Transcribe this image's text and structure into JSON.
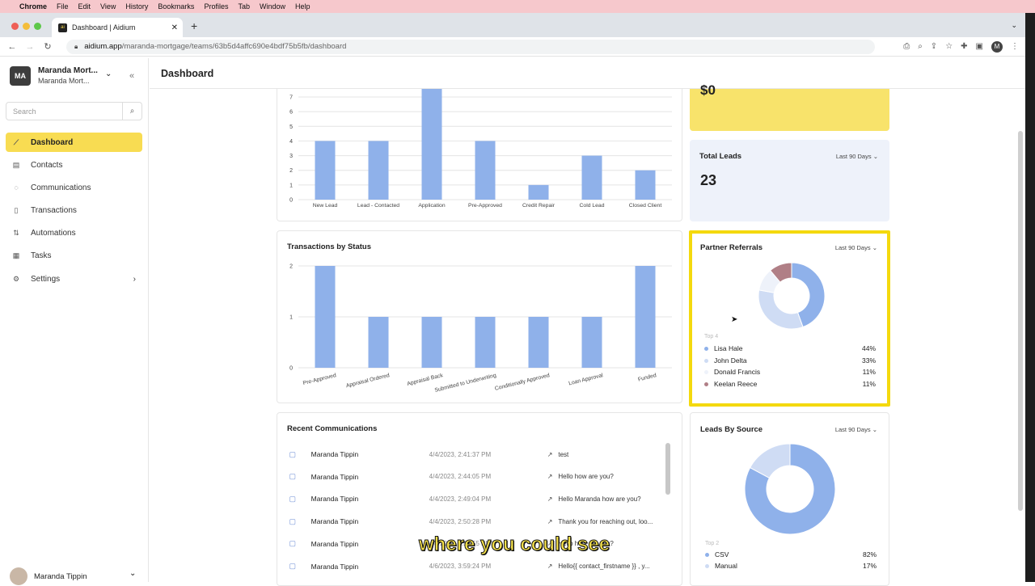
{
  "menubar": {
    "app": "Chrome",
    "items": [
      "File",
      "Edit",
      "View",
      "History",
      "Bookmarks",
      "Profiles",
      "Tab",
      "Window",
      "Help"
    ]
  },
  "browser": {
    "tab_title": "Dashboard | Aidium",
    "url_host": "aidium.app",
    "url_path": "/maranda-mortgage/teams/63b5d4affc690e4bdf75b5fb/dashboard",
    "profile_initial": "M"
  },
  "sidebar": {
    "org_initials": "MA",
    "org_name": "Maranda Mort...",
    "org_sub": "Maranda Mort...",
    "search_placeholder": "Search",
    "items": [
      {
        "label": "Dashboard",
        "icon": "chart-line-icon",
        "active": true
      },
      {
        "label": "Contacts",
        "icon": "contacts-icon"
      },
      {
        "label": "Communications",
        "icon": "chat-icon"
      },
      {
        "label": "Transactions",
        "icon": "document-icon"
      },
      {
        "label": "Automations",
        "icon": "automation-icon"
      },
      {
        "label": "Tasks",
        "icon": "calendar-icon"
      },
      {
        "label": "Settings",
        "icon": "gear-icon"
      }
    ],
    "user_name": "Maranda Tippin"
  },
  "header": {
    "title": "Dashboard"
  },
  "stats": {
    "revenue_value": "$0",
    "total_leads_title": "Total Leads",
    "total_leads_range": "Last 90 Days",
    "total_leads_value": "23"
  },
  "leads_chart": {
    "chart_data": {
      "type": "bar",
      "categories": [
        "New Lead",
        "Lead - Contacted",
        "Application",
        "Pre-Approved",
        "Credit Repair",
        "Cold Lead",
        "Closed Client"
      ],
      "values": [
        4,
        4,
        8,
        4,
        1,
        3,
        2
      ],
      "ylim": [
        0,
        7
      ],
      "yticks": [
        0,
        1,
        2,
        3,
        4,
        5,
        6,
        7
      ]
    }
  },
  "transactions_chart": {
    "title": "Transactions by Status",
    "chart_data": {
      "type": "bar",
      "title": "Transactions by Status",
      "categories": [
        "Pre-Approved",
        "Appraisal Ordered",
        "Appraisal Back",
        "Submitted to Underwriting",
        "Conditionally Approved",
        "Loan Approval",
        "Funded"
      ],
      "values": [
        2,
        1,
        1,
        1,
        1,
        1,
        2
      ],
      "ylim": [
        0,
        2
      ],
      "yticks": [
        0,
        1,
        2
      ]
    }
  },
  "partner_referrals": {
    "title": "Partner Referrals",
    "range": "Last 90 Days",
    "top_label": "Top 4",
    "chart_data": {
      "type": "pie",
      "categories": [
        "Lisa Hale",
        "John Delta",
        "Donald Francis",
        "Keelan Reece"
      ],
      "values": [
        44,
        33,
        11,
        11
      ],
      "labels": [
        "44%",
        "33%",
        "11%",
        "11%"
      ],
      "colors": [
        "#8fb1ea",
        "#cfdcf4",
        "#eef2fa",
        "#b07f86"
      ]
    }
  },
  "leads_by_source": {
    "title": "Leads By Source",
    "range": "Last 90 Days",
    "top_label": "Top 2",
    "chart_data": {
      "type": "pie",
      "categories": [
        "CSV",
        "Manual"
      ],
      "values": [
        82,
        17
      ],
      "labels": [
        "82%",
        "17%"
      ],
      "colors": [
        "#8fb1ea",
        "#cfdcf4"
      ]
    }
  },
  "communications": {
    "title": "Recent Communications",
    "rows": [
      {
        "name": "Maranda Tippin",
        "date": "4/4/2023, 2:41:37 PM",
        "message": "test"
      },
      {
        "name": "Maranda Tippin",
        "date": "4/4/2023, 2:44:05 PM",
        "message": "Hello how are you?"
      },
      {
        "name": "Maranda Tippin",
        "date": "4/4/2023, 2:49:04 PM",
        "message": "Hello Maranda how are you?"
      },
      {
        "name": "Maranda Tippin",
        "date": "4/4/2023, 2:50:28 PM",
        "message": "Thank you for reaching out, loo..."
      },
      {
        "name": "Maranda Tippin",
        "date": "4/4/2023, 2:52:55 PM",
        "message": "Hello how are you?"
      },
      {
        "name": "Maranda Tippin",
        "date": "4/6/2023, 3:59:24 PM",
        "message": "Hello{{ contact_firstname }} , y..."
      }
    ]
  },
  "subtitle": "where you could see",
  "colors": {
    "accent": "#f8dc52",
    "bar": "#8fb1ea",
    "highlight": "#f4d90e",
    "card_blue": "#eef2fa"
  }
}
